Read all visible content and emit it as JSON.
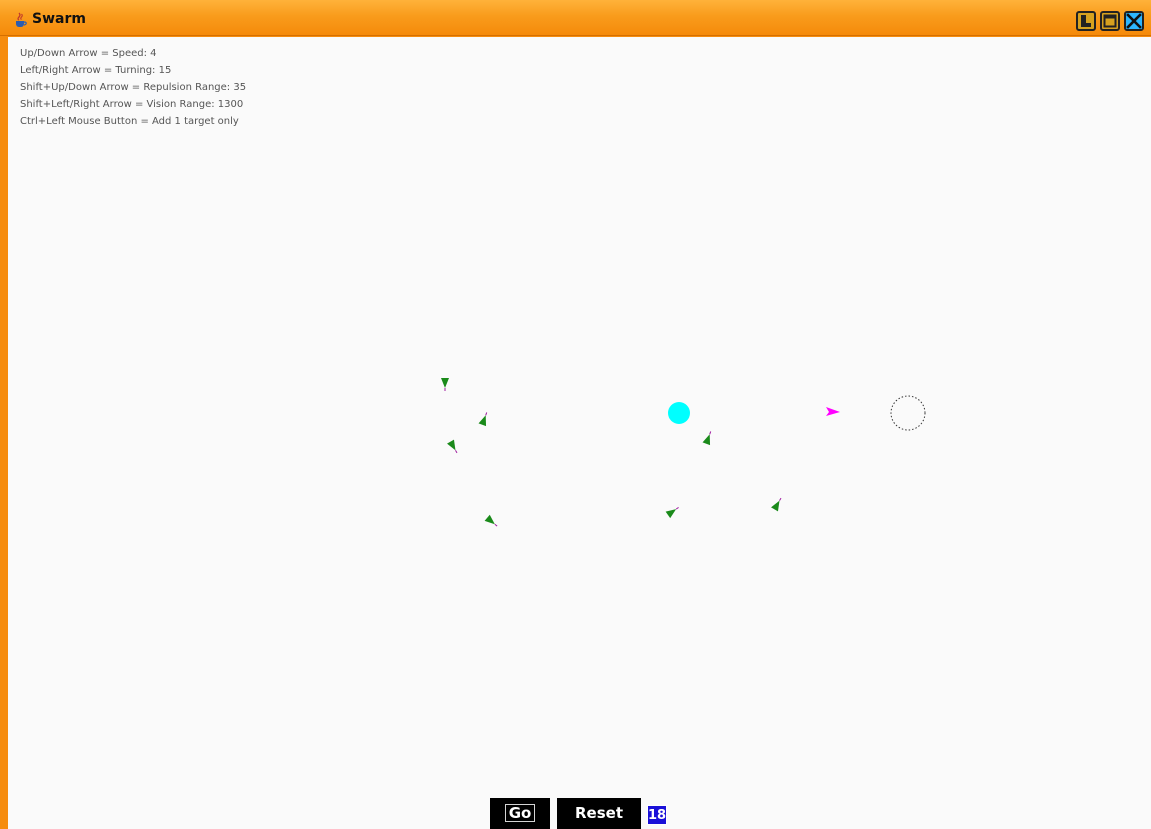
{
  "window": {
    "title": "Swarm",
    "icon": "java-cup-icon",
    "buttons": [
      "minimize-icon",
      "maximize-icon",
      "close-icon"
    ]
  },
  "help_lines": [
    "Up/Down Arrow = Speed: 4",
    "Left/Right Arrow = Turning: 15",
    "Shift+Up/Down Arrow = Repulsion Range: 35",
    "Shift+Left/Right Arrow = Vision Range: 1300",
    "Ctrl+Left Mouse Button = Add 1 target only"
  ],
  "controls": {
    "go_label": "Go",
    "reset_label": "Reset",
    "count": "18"
  },
  "colors": {
    "title_bar": "#f99c1c",
    "agent": "#1a8a1a",
    "agent_tip": "#d01ad0",
    "leader": "#ff00ff",
    "target": "#00ffff",
    "counter_bg": "#1a10d8"
  }
}
